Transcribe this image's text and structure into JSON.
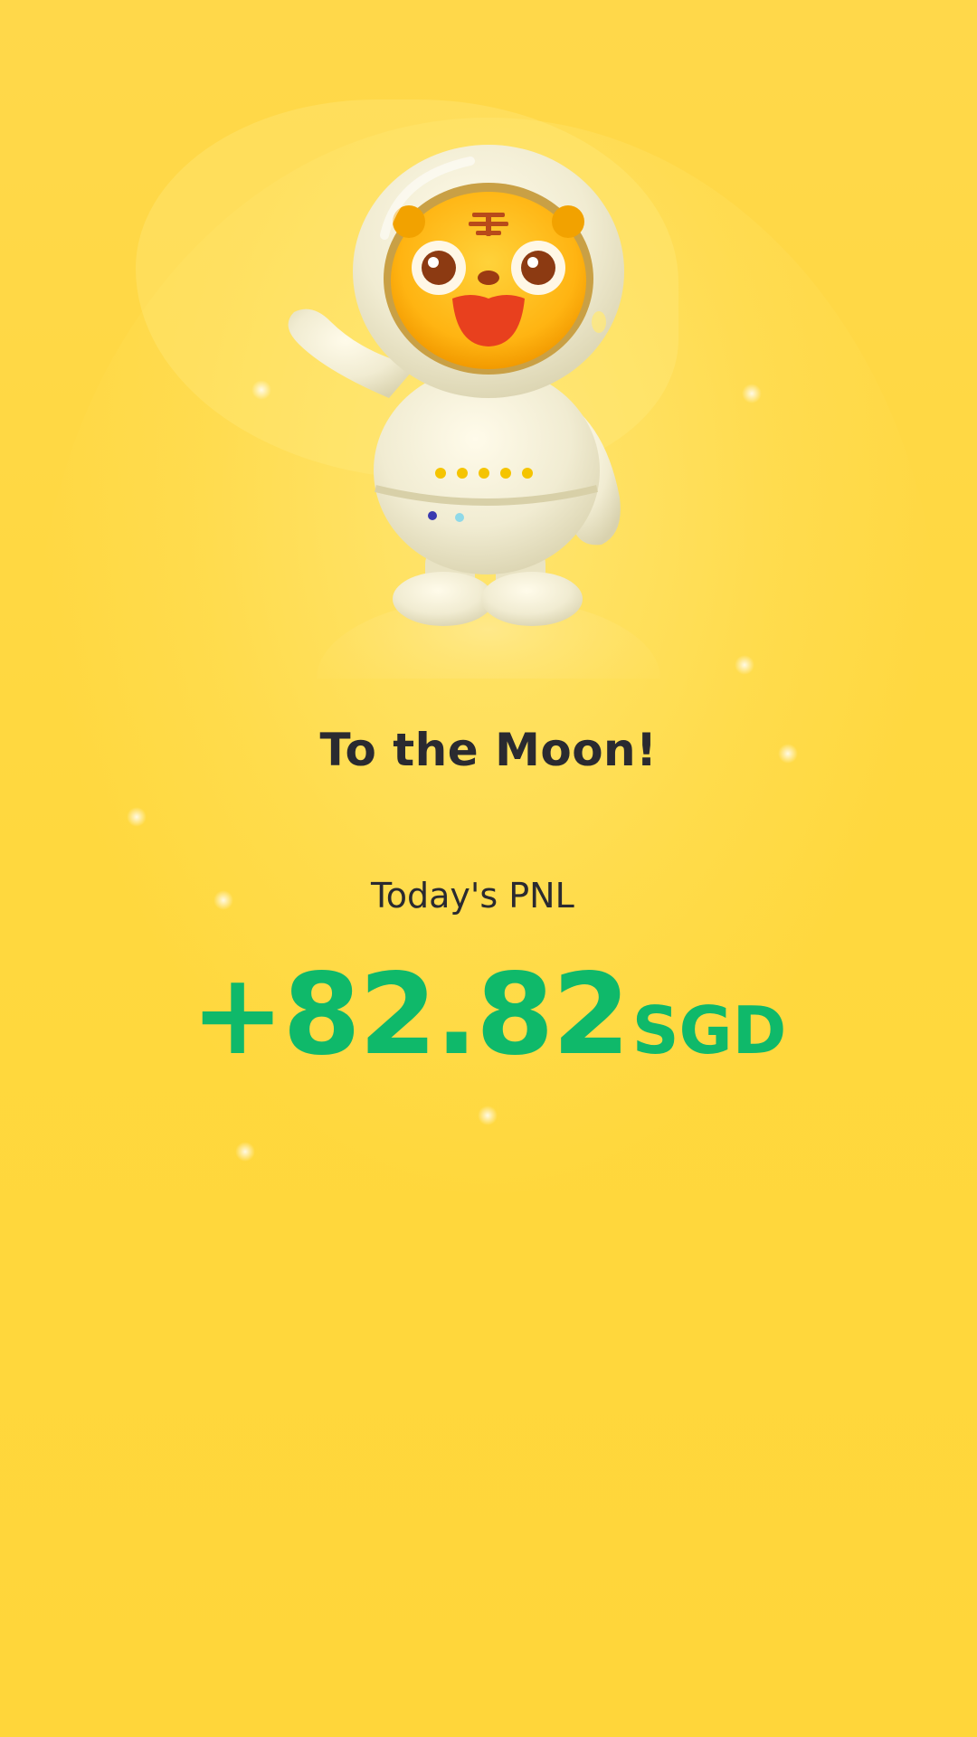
{
  "mascot": {
    "icon": "astronaut-tiger-mascot-icon",
    "helmet_emblem": "王"
  },
  "headline": "To the Moon!",
  "pnl": {
    "label": "Today's PNL",
    "amount": "+82.82",
    "currency": "SGD"
  },
  "colors": {
    "background": "#FFD83E",
    "text_dark": "#2A2A30",
    "positive_green": "#0FB96A"
  }
}
